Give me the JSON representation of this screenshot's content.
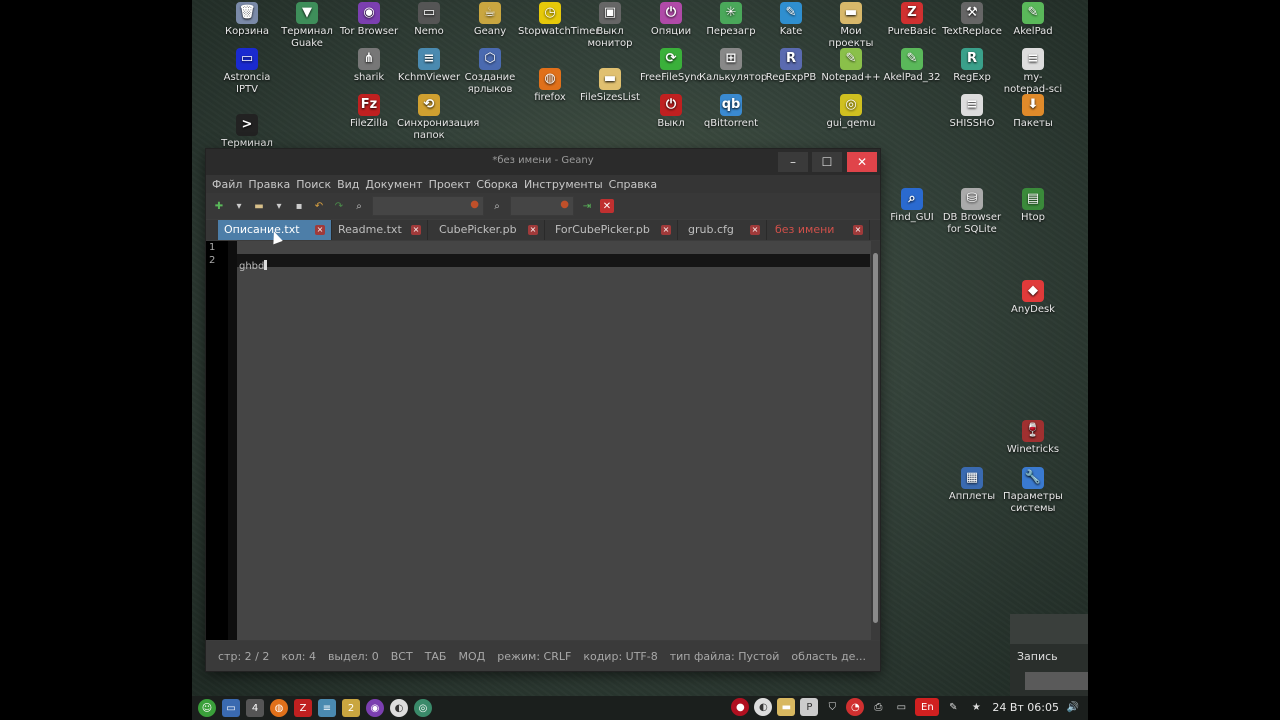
{
  "desktop_icons": [
    {
      "label": "Корзина",
      "icon": "trash-icon",
      "color": "#7a8aa8",
      "glyph": "🗑"
    },
    {
      "label": "Терминал Guake",
      "icon": "guake-icon",
      "color": "#3e8e5a",
      "glyph": "▼"
    },
    {
      "label": "Tor Browser",
      "icon": "tor-icon",
      "color": "#7b3fb0",
      "glyph": "◉"
    },
    {
      "label": "Nemo",
      "icon": "nemo-icon",
      "color": "#555",
      "glyph": "▭"
    },
    {
      "label": "Geany",
      "icon": "geany-icon",
      "color": "#c9a640",
      "glyph": "☕"
    },
    {
      "label": "StopwatchTimer",
      "icon": "stopwatch-icon",
      "color": "#e6c90a",
      "glyph": "◷"
    },
    {
      "label": "Выкл монитор",
      "icon": "monitor-off-icon",
      "color": "#666",
      "glyph": "▣"
    },
    {
      "label": "Опяции",
      "icon": "power-icon",
      "color": "#b04aa8",
      "glyph": "⏻"
    },
    {
      "label": "Перезагр",
      "icon": "reboot-icon",
      "color": "#4aa85a",
      "glyph": "✳"
    },
    {
      "label": "Kate",
      "icon": "kate-icon",
      "color": "#2f8fd0",
      "glyph": "✎"
    },
    {
      "label": "Мои проекты",
      "icon": "folder-icon",
      "color": "#d8b86a",
      "glyph": "▬"
    },
    {
      "label": "PureBasic",
      "icon": "purebasic-icon",
      "color": "#d03030",
      "glyph": "Z"
    },
    {
      "label": "TextReplace",
      "icon": "textreplace-icon",
      "color": "#666",
      "glyph": "⚒"
    },
    {
      "label": "AkelPad",
      "icon": "akelpad-icon",
      "color": "#5ab85a",
      "glyph": "✎"
    },
    {
      "label": "Astroncia IPTV",
      "icon": "tv-icon",
      "color": "#1a2ad0",
      "glyph": "▭"
    },
    {
      "label": "sharik",
      "icon": "sharik-icon",
      "color": "#777",
      "glyph": "⋔"
    },
    {
      "label": "KchmViewer",
      "icon": "kchm-icon",
      "color": "#4a8ab0",
      "glyph": "≡"
    },
    {
      "label": "Создание ярлыков",
      "icon": "shortcut-icon",
      "color": "#4a6ab0",
      "glyph": "⬡"
    },
    {
      "label": "firefox",
      "icon": "firefox-icon",
      "color": "#e0701a",
      "glyph": "◍"
    },
    {
      "label": "FileSizesList",
      "icon": "folder-icon",
      "color": "#e0c070",
      "glyph": "▬"
    },
    {
      "label": "FreeFileSync",
      "icon": "sync-icon",
      "color": "#3ab03a",
      "glyph": "⟳"
    },
    {
      "label": "Калькулятор",
      "icon": "calculator-icon",
      "color": "#888",
      "glyph": "⊞"
    },
    {
      "label": "RegExpPB",
      "icon": "regexp-icon",
      "color": "#5a6ab0",
      "glyph": "R"
    },
    {
      "label": "Notepad++",
      "icon": "notepadpp-icon",
      "color": "#8ac04a",
      "glyph": "✎"
    },
    {
      "label": "AkelPad_32",
      "icon": "akelpad-icon",
      "color": "#5ab85a",
      "glyph": "✎"
    },
    {
      "label": "RegExp",
      "icon": "regexp-icon",
      "color": "#3aa08a",
      "glyph": "R"
    },
    {
      "label": "my-notepad-sci",
      "icon": "notepad-icon",
      "color": "#ddd",
      "glyph": "≡"
    },
    {
      "label": "Терминал",
      "icon": "terminal-icon",
      "color": "#222",
      "glyph": ">"
    },
    {
      "label": "FileZilla",
      "icon": "filezilla-icon",
      "color": "#c02020",
      "glyph": "Fz"
    },
    {
      "label": "Синхронизация папок",
      "icon": "folder-sync-icon",
      "color": "#d0a030",
      "glyph": "⟲"
    },
    {
      "label": "Выкл",
      "icon": "power-icon",
      "color": "#c02020",
      "glyph": "⏻"
    },
    {
      "label": "qBittorrent",
      "icon": "qbittorrent-icon",
      "color": "#3a8ad0",
      "glyph": "qb"
    },
    {
      "label": "gui_qemu",
      "icon": "qemu-icon",
      "color": "#d0c020",
      "glyph": "◎"
    },
    {
      "label": "SHISSHO",
      "icon": "document-icon",
      "color": "#ddd",
      "glyph": "≡"
    },
    {
      "label": "Пакеты",
      "icon": "packages-icon",
      "color": "#e08a2a",
      "glyph": "⬇"
    },
    {
      "label": "Find_GUI",
      "icon": "search-icon",
      "color": "#2a6ad0",
      "glyph": "⌕"
    },
    {
      "label": "DB Browser for SQLite",
      "icon": "database-icon",
      "color": "#aaa",
      "glyph": "⛁"
    },
    {
      "label": "Htop",
      "icon": "htop-icon",
      "color": "#3a8a3a",
      "glyph": "▤"
    },
    {
      "label": "AnyDesk",
      "icon": "anydesk-icon",
      "color": "#e03a3a",
      "glyph": "◆"
    },
    {
      "label": "Winetricks",
      "icon": "winetricks-icon",
      "color": "#a03030",
      "glyph": "🍷"
    },
    {
      "label": "Апплеты",
      "icon": "applets-icon",
      "color": "#3a6ab0",
      "glyph": "▦"
    },
    {
      "label": "Параметры системы",
      "icon": "settings-icon",
      "color": "#3a7ad0",
      "glyph": "🔧"
    }
  ],
  "window": {
    "title": "*без имени - Geany",
    "min_glyph": "–",
    "max_glyph": "☐",
    "close_glyph": "✕"
  },
  "menu": [
    "Файл",
    "Правка",
    "Поиск",
    "Вид",
    "Документ",
    "Проект",
    "Сборка",
    "Инструменты",
    "Справка"
  ],
  "tabs": [
    {
      "label": "Описание.txt"
    },
    {
      "label": "Readme.txt"
    },
    {
      "label": "CubePicker.pb"
    },
    {
      "label": "ForCubePicker.pb"
    },
    {
      "label": "grub.cfg"
    },
    {
      "label": "без имени"
    }
  ],
  "editor": {
    "line_numbers": [
      "1",
      "2"
    ],
    "line2_text": "ghbd"
  },
  "status": {
    "line": "стр: 2 / 2",
    "col": "кол: 4",
    "sel": "выдел: 0",
    "ins": "ВСТ",
    "tab": "ТАБ",
    "mod": "МОД",
    "mode": "режим: CRLF",
    "enc": "кодир: UTF-8",
    "ftype": "тип файла: Пустой",
    "scope": "область де..."
  },
  "record_panel": {
    "label": "Запись"
  },
  "taskbar": {
    "clock": "24 Вт 06:05"
  }
}
